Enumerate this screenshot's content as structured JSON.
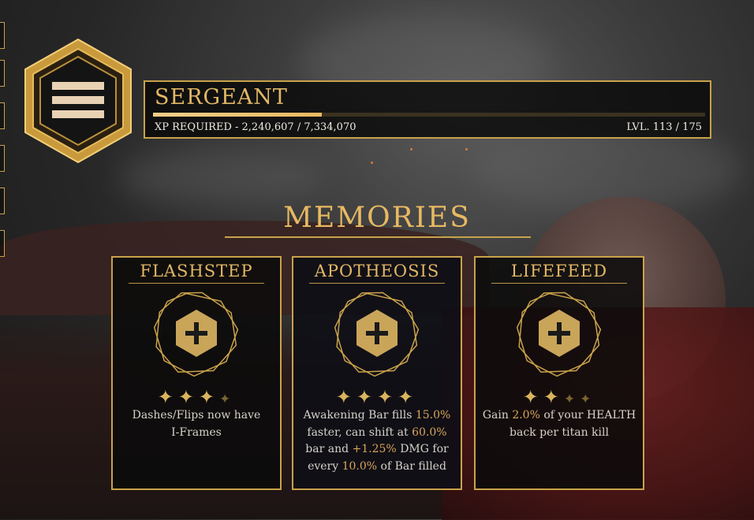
{
  "rank": {
    "title": "SERGEANT",
    "xp_label": "XP REQUIRED - 2,240,607 / 7,334,070",
    "xp_progress": 0.305,
    "level_label": "LVL. 113 / 175"
  },
  "memories": {
    "heading": "MEMORIES",
    "cards": [
      {
        "title": "FLASHSTEP",
        "stars_filled": 3,
        "stars_total": 4,
        "desc_1": "Dashes/Flips now have",
        "desc_2": "I-Frames"
      },
      {
        "title": "APOTHEOSIS",
        "stars_filled": 4,
        "stars_total": 4,
        "d_a": "Awakening Bar fills ",
        "d_b": "15.0%",
        "d_c": " faster, can shift at ",
        "d_d": "60.0%",
        "d_e": " bar and ",
        "d_f": "+1.25%",
        "d_g": " DMG for every ",
        "d_h": "10.0%",
        "d_i": " of Bar filled"
      },
      {
        "title": "LIFEFEED",
        "stars_filled": 2,
        "stars_total": 4,
        "d_a": "Gain ",
        "d_b": "2.0%",
        "d_c": " of your HEALTH back per titan kill"
      }
    ]
  },
  "colors": {
    "gold": "#c9a24a",
    "gold_text": "#e2b865",
    "highlight": "#d8a55a"
  },
  "icons": [
    "rank-emblem-icon",
    "star-icon",
    "plus-hexagon-icon"
  ]
}
